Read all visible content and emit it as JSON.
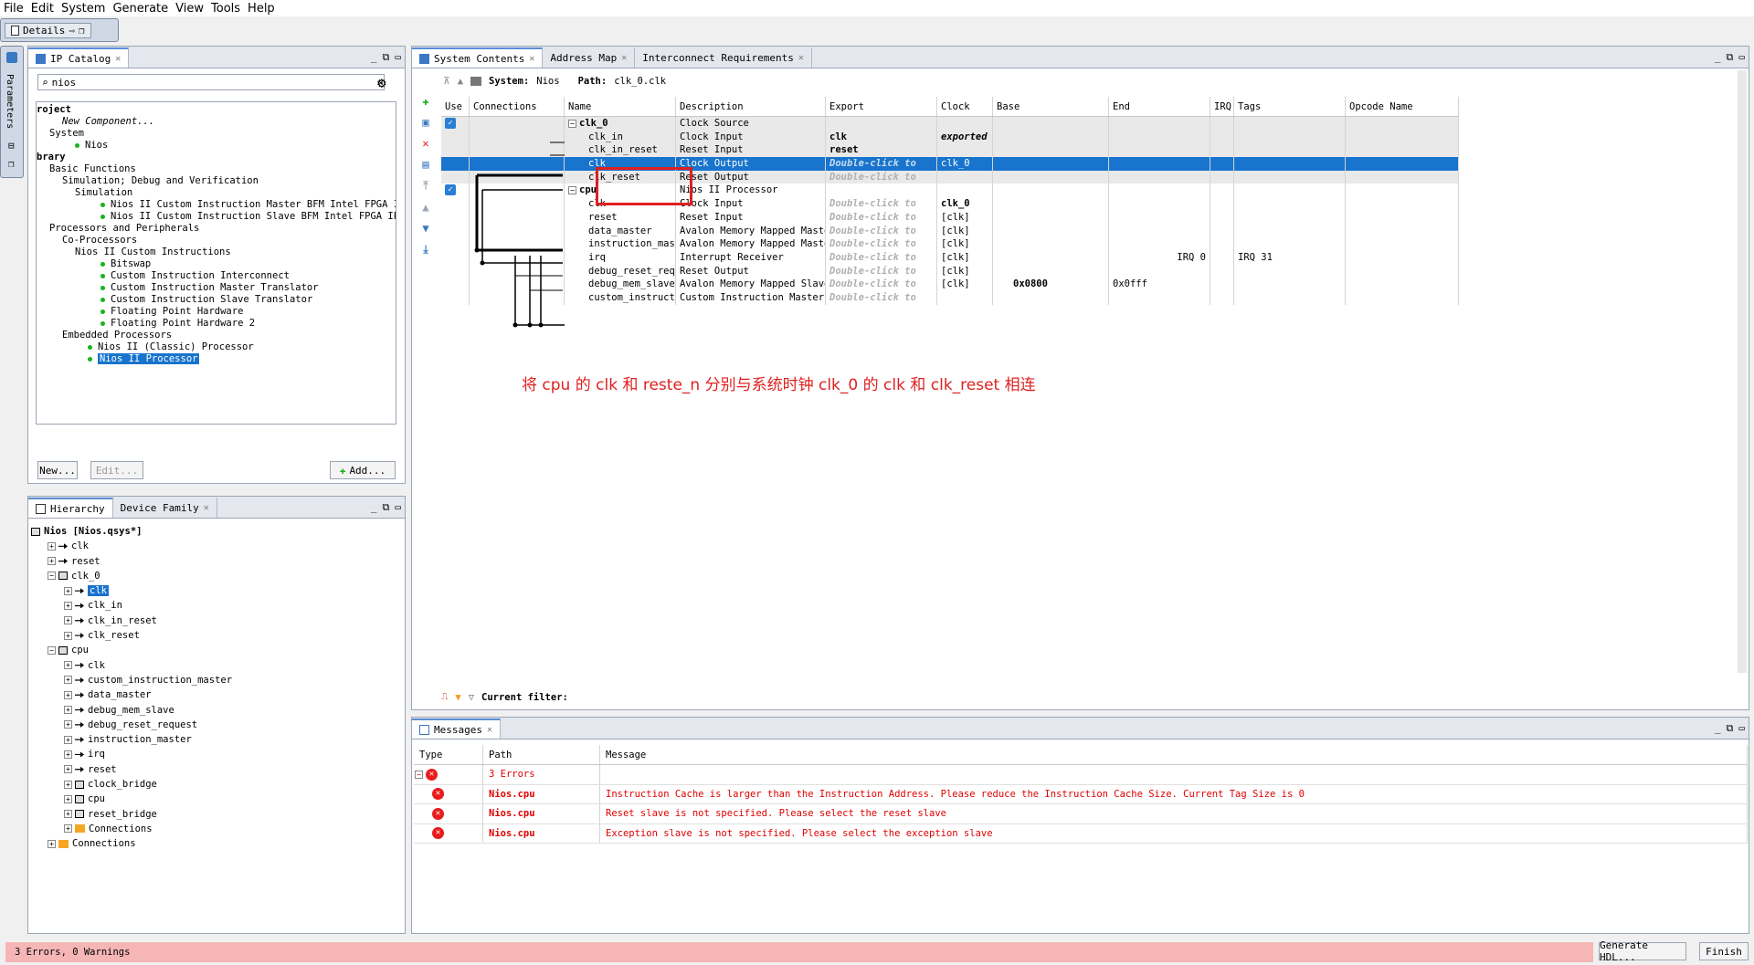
{
  "menu": [
    "File",
    "Edit",
    "System",
    "Generate",
    "View",
    "Tools",
    "Help"
  ],
  "toolbar": {
    "details_tab": "Details"
  },
  "side_strip": {
    "label": "Parameters"
  },
  "ip_catalog": {
    "tab": "IP Catalog",
    "search_value": "nios",
    "tree": [
      {
        "text": "roject",
        "indent": 0,
        "bold": true
      },
      {
        "text": "New Component...",
        "indent": 2,
        "italic": true
      },
      {
        "text": "System",
        "indent": 1
      },
      {
        "text": "Nios",
        "indent": 3,
        "dot": true
      },
      {
        "text": "brary",
        "indent": 0,
        "bold": true
      },
      {
        "text": "Basic Functions",
        "indent": 1
      },
      {
        "text": "Simulation; Debug and Verification",
        "indent": 2
      },
      {
        "text": "Simulation",
        "indent": 3
      },
      {
        "text": "Nios II Custom Instruction Master BFM Intel FPGA IP",
        "indent": 5,
        "dot": true
      },
      {
        "text": "Nios II Custom Instruction Slave BFM Intel FPGA IP",
        "indent": 5,
        "dot": true
      },
      {
        "text": "Processors and Peripherals",
        "indent": 1
      },
      {
        "text": "Co-Processors",
        "indent": 2
      },
      {
        "text": "Nios II Custom Instructions",
        "indent": 3
      },
      {
        "text": "Bitswap",
        "indent": 5,
        "dot": true
      },
      {
        "text": "Custom Instruction Interconnect",
        "indent": 5,
        "dot": true
      },
      {
        "text": "Custom Instruction Master Translator",
        "indent": 5,
        "dot": true
      },
      {
        "text": "Custom Instruction Slave Translator",
        "indent": 5,
        "dot": true
      },
      {
        "text": "Floating Point Hardware",
        "indent": 5,
        "dot": true
      },
      {
        "text": "Floating Point Hardware 2",
        "indent": 5,
        "dot": true
      },
      {
        "text": "Embedded Processors",
        "indent": 2
      },
      {
        "text": "Nios II (Classic) Processor",
        "indent": 4,
        "dot": true
      },
      {
        "text": "Nios II Processor",
        "indent": 4,
        "dot": true,
        "selected": true
      }
    ],
    "new_btn": "New...",
    "edit_btn": "Edit...",
    "add_btn": "Add..."
  },
  "hierarchy": {
    "tab1": "Hierarchy",
    "tab2": "Device Family",
    "rows": [
      {
        "text": "Nios [Nios.qsys*]",
        "indent": 0,
        "bold": true,
        "icon": "chip"
      },
      {
        "text": "clk",
        "indent": 1,
        "icon": "port"
      },
      {
        "text": "reset",
        "indent": 1,
        "icon": "port"
      },
      {
        "text": "clk_0",
        "indent": 1,
        "icon": "chip",
        "expanded": true
      },
      {
        "text": "clk",
        "indent": 2,
        "icon": "port",
        "selected": true
      },
      {
        "text": "clk_in",
        "indent": 2,
        "icon": "port"
      },
      {
        "text": "clk_in_reset",
        "indent": 2,
        "icon": "port"
      },
      {
        "text": "clk_reset",
        "indent": 2,
        "icon": "port"
      },
      {
        "text": "cpu",
        "indent": 1,
        "icon": "chip",
        "expanded": true
      },
      {
        "text": "clk",
        "indent": 2,
        "icon": "port"
      },
      {
        "text": "custom_instruction_master",
        "indent": 2,
        "icon": "port"
      },
      {
        "text": "data_master",
        "indent": 2,
        "icon": "port"
      },
      {
        "text": "debug_mem_slave",
        "indent": 2,
        "icon": "port"
      },
      {
        "text": "debug_reset_request",
        "indent": 2,
        "icon": "port"
      },
      {
        "text": "instruction_master",
        "indent": 2,
        "icon": "port"
      },
      {
        "text": "irq",
        "indent": 2,
        "icon": "port"
      },
      {
        "text": "reset",
        "indent": 2,
        "icon": "port"
      },
      {
        "text": "clock_bridge",
        "indent": 2,
        "icon": "chip"
      },
      {
        "text": "cpu",
        "indent": 2,
        "icon": "chip"
      },
      {
        "text": "reset_bridge",
        "indent": 2,
        "icon": "chip"
      },
      {
        "text": "Connections",
        "indent": 2,
        "icon": "folder"
      },
      {
        "text": "Connections",
        "indent": 1,
        "icon": "folder"
      }
    ]
  },
  "system_contents": {
    "tabs": [
      "System Contents",
      "Address Map",
      "Interconnect Requirements"
    ],
    "system_label": "System:",
    "system_value": "Nios",
    "path_label": "Path:",
    "path_value": "clk_0.clk",
    "columns": [
      "Use",
      "Connections",
      "Name",
      "Description",
      "Export",
      "Clock",
      "Base",
      "End",
      "IRQ",
      "Tags",
      "Opcode Name"
    ],
    "rows": [
      {
        "use": true,
        "name": "clk_0",
        "name_bold": true,
        "expander": true,
        "desc": "Clock Source",
        "export": "",
        "clock": "",
        "base": "",
        "end": "",
        "irq": ""
      },
      {
        "name": "clk_in",
        "desc": "Clock Input",
        "export": "clk",
        "export_bold": true,
        "clock": "exported",
        "clock_style": "bolditalic"
      },
      {
        "name": "clk_in_reset",
        "desc": "Reset Input",
        "export": "reset",
        "export_bold": true,
        "clock": ""
      },
      {
        "name": "clk",
        "desc": "Clock Output",
        "export": "Double-click to",
        "export_dbl": true,
        "clock": "clk_0",
        "highlight": true
      },
      {
        "name": "clk_reset",
        "desc": "Reset Output",
        "export": "Double-click to",
        "export_dbl": true,
        "clock": ""
      },
      {
        "use": true,
        "name": "cpu",
        "name_bold": true,
        "expander": true,
        "desc": "Nios II Processor",
        "export": "",
        "clock": "",
        "white": true
      },
      {
        "name": "clk",
        "desc": "Clock Input",
        "export": "Double-click to",
        "export_dbl": true,
        "clock": "clk_0",
        "clock_bold": true,
        "white": true
      },
      {
        "name": "reset",
        "desc": "Reset Input",
        "export": "Double-click to",
        "export_dbl": true,
        "clock": "[clk]",
        "white": true
      },
      {
        "name": "data_master",
        "desc": "Avalon Memory Mapped Master",
        "export": "Double-click to",
        "export_dbl": true,
        "clock": "[clk]",
        "white": true
      },
      {
        "name": "instruction_master",
        "desc": "Avalon Memory Mapped Master",
        "export": "Double-click to",
        "export_dbl": true,
        "clock": "[clk]",
        "white": true
      },
      {
        "name": "irq",
        "desc": "Interrupt Receiver",
        "export": "Double-click to",
        "export_dbl": true,
        "clock": "[clk]",
        "base": "",
        "end": "IRQ 0",
        "tags": "IRQ 31",
        "white": true
      },
      {
        "name": "debug_reset_request",
        "desc": "Reset Output",
        "export": "Double-click to",
        "export_dbl": true,
        "clock": "[clk]",
        "white": true
      },
      {
        "name": "debug_mem_slave",
        "desc": "Avalon Memory Mapped Slave",
        "export": "Double-click to",
        "export_dbl": true,
        "clock": "[clk]",
        "base": "0x0800",
        "end": "0x0fff",
        "white": true
      },
      {
        "name": "custom_instructi...",
        "desc": "Custom Instruction Master",
        "export": "Double-click to",
        "export_dbl": true,
        "clock": "",
        "white": true
      }
    ],
    "annotation": "将 cpu 的 clk 和 reste_n 分别与系统时钟 clk_0 的 clk 和 clk_reset 相连",
    "filter_label": "Current filter:"
  },
  "messages": {
    "tab": "Messages",
    "columns": [
      "Type",
      "Path",
      "Message"
    ],
    "summary": "3 Errors",
    "rows": [
      {
        "path": "Nios.cpu",
        "message": "Instruction Cache is larger than the Instruction Address. Please reduce the Instruction Cache Size. Current Tag Size is 0"
      },
      {
        "path": "Nios.cpu",
        "message": "Reset slave is not specified. Please select the reset slave"
      },
      {
        "path": "Nios.cpu",
        "message": "Exception slave is not specified. Please select the exception slave"
      }
    ]
  },
  "status": {
    "text": "3 Errors, 0 Warnings",
    "generate_btn": "Generate HDL...",
    "finish_btn": "Finish"
  },
  "colors": {
    "selection": "#1874cd",
    "error": "#e00000",
    "status_bg": "#f6b6b6",
    "annotation": "#e02020"
  }
}
